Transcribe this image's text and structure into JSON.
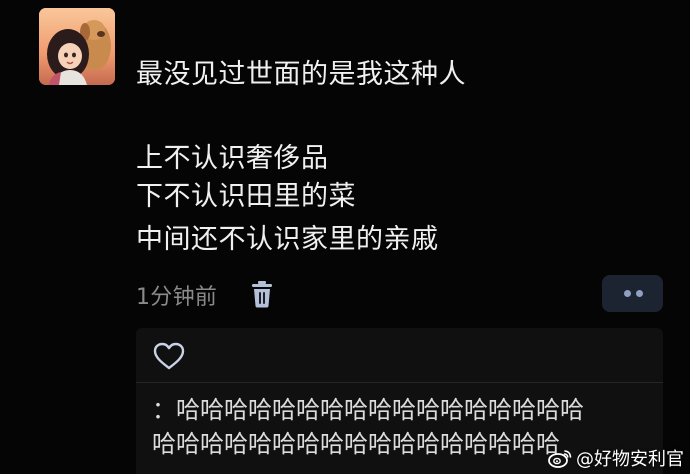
{
  "post": {
    "lines": [
      "最没见过世面的是我这种人",
      "上不认识奢侈品",
      "下不认识田里的菜",
      "中间还不认识家里的亲戚"
    ],
    "timestamp": "1分钟前"
  },
  "icons": {
    "delete": "trash-icon",
    "more": "more-dots-icon",
    "like": "heart-outline-icon",
    "watermark": "weibo-logo-icon"
  },
  "comment": {
    "line1": "：哈哈哈哈哈哈哈哈哈哈哈哈哈哈哈哈哈",
    "line2": "哈哈哈哈哈哈哈哈哈哈哈哈哈哈哈哈哈"
  },
  "watermark": {
    "text": "@好物安利官"
  },
  "colors": {
    "background": "#050505",
    "text": "#f0f0f0",
    "muted": "#8a8a8a",
    "accent_button": "#1d2431",
    "dot": "#8fa0c2",
    "panel": "#101010"
  }
}
